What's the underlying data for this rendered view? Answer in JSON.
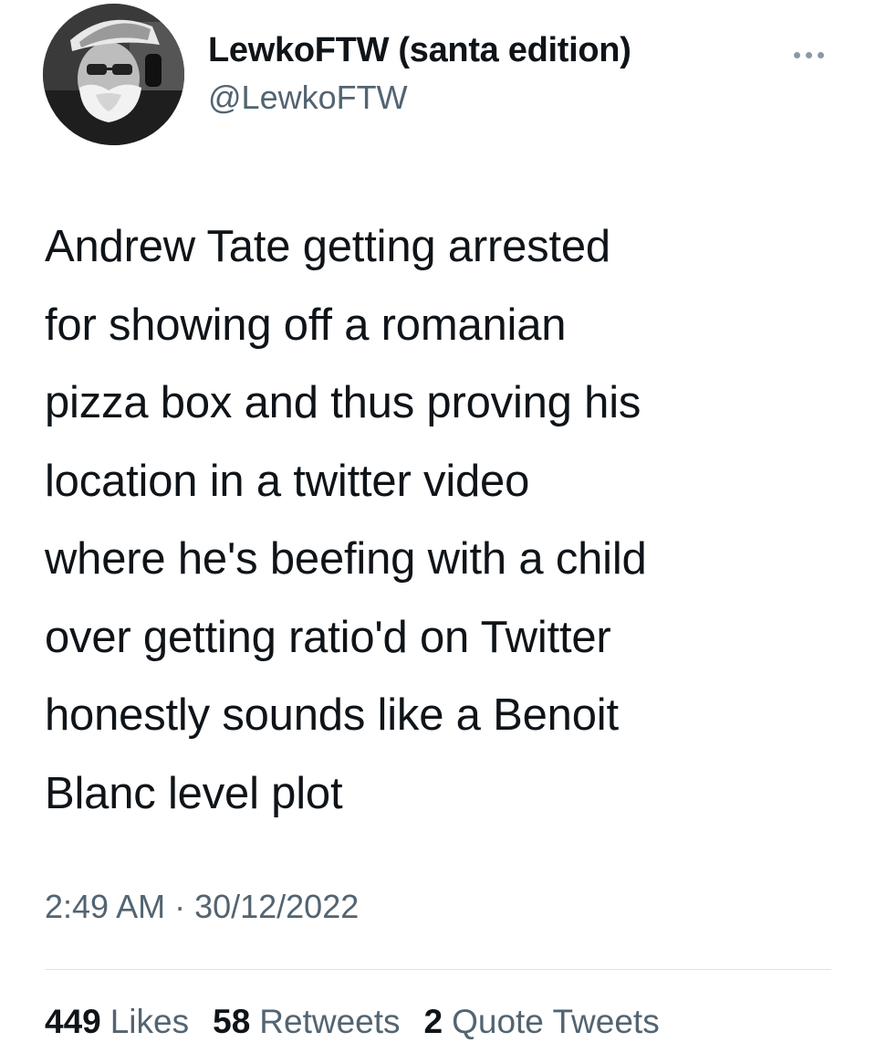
{
  "author": {
    "display_name": "LewkoFTW (santa edition)",
    "handle": "@LewkoFTW",
    "avatar_icon": "santa-hat-avatar"
  },
  "menu": {
    "icon": "more-options-icon"
  },
  "tweet": {
    "text": "Andrew Tate getting arrested\nfor showing off a romanian\npizza box and thus proving his\nlocation in a twitter video\nwhere he's beefing with a child\nover getting ratio'd on Twitter\nhonestly sounds like a Benoit\nBlanc level plot",
    "timestamp": "2:49 AM · 30/12/2022"
  },
  "stats": {
    "likes": {
      "count": "449",
      "label": "Likes"
    },
    "retweets": {
      "count": "58",
      "label": "Retweets"
    },
    "quotes": {
      "count": "2",
      "label": "Quote Tweets"
    }
  },
  "colors": {
    "text_primary": "#0f1419",
    "text_secondary": "#536471",
    "divider": "#dfe3e6"
  }
}
